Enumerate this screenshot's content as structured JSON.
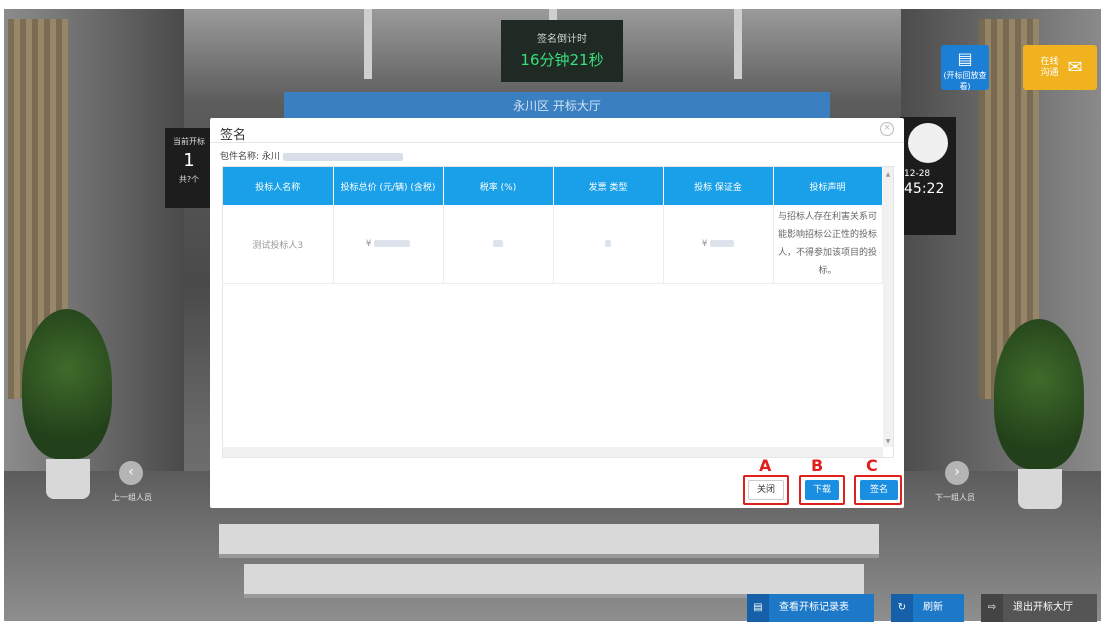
{
  "countdown": {
    "label": "签名倒计时",
    "value": "16分钟21秒"
  },
  "hall_banner": "永川区 开标大厅",
  "left_board": {
    "label": "当前开标",
    "number": "1",
    "sub": "共?个"
  },
  "top_right": {
    "review_label": "(开标回放查看)",
    "chat_label": "在线沟通"
  },
  "clock": {
    "date": "12-28",
    "time": "45:22"
  },
  "nav": {
    "prev_label": "上一组人员",
    "next_label": "下一组人员"
  },
  "modal": {
    "title": "签名",
    "package_label": "包件名称: 永川",
    "table": {
      "headers": [
        "投标人名称",
        "投标总价 (元/辆) (含税)",
        "税率 (%)",
        "发票 类型",
        "投标 保证金",
        "投标声明"
      ],
      "rows": [
        {
          "cells": [
            "测试投标人3",
            "¥",
            "",
            "",
            "¥",
            "与招标人存在利害关系可能影响招标公正性的投标人，不得参加该项目的投标。"
          ]
        }
      ]
    },
    "buttons": {
      "close": "关闭",
      "download": "下载",
      "sign": "签名"
    },
    "markers": {
      "a": "A",
      "b": "B",
      "c": "C"
    }
  },
  "bottom": {
    "records": "查看开标记录表",
    "refresh": "刷新",
    "exit": "退出开标大厅"
  },
  "colors": {
    "primary": "#1a8ee0",
    "header": "#1aa0e8",
    "highlight": "#e0201d"
  }
}
